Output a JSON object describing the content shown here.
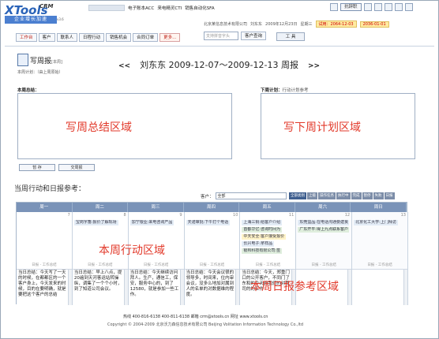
{
  "app": {
    "logo": "XTools",
    "logo_suffix": "CRM",
    "slogan": "企业增长加速",
    "version": "v3.6"
  },
  "topnav": [
    "电子账本ACC",
    "来电精灵CTI",
    "销售自动化SFA"
  ],
  "header": {
    "resign": "抗辞职",
    "company": "北京某信息技术有限公司",
    "user": "刘东东",
    "date": "2009年12月23日",
    "weekday": "星期三",
    "trial": "试用：2064-12-03",
    "end_date": "2036-01-01"
  },
  "nav": {
    "buttons": [
      "工作台",
      "客户",
      "联系人",
      "日程行动",
      "销售机会",
      "合同订单",
      "更多..."
    ],
    "search_placeholder": "支持拼音字头",
    "search_button": "客户查询",
    "tools": "工 具"
  },
  "report": {
    "title": "写周报",
    "subtitle": "[本周]",
    "prev": "<<",
    "next": ">>",
    "week_label": "刘东东 2009-12-07～2009-12-13 周报",
    "plan_hint": "本周计划：（由上周原始）",
    "summary_label": "本周总结：",
    "next_plan_label": "下周计划：",
    "next_plan_ref": "行动计划参考",
    "summary_area": "写周总结区域",
    "plan_area": "写下周计划区域",
    "save": "暂 存",
    "submit": "交周报"
  },
  "reference": {
    "title": "当周行动和日报参考：",
    "customer_label": "客户：",
    "customer_value": "全部",
    "filters": [
      "全部类别",
      "上级",
      "操作任务",
      "执行中",
      "完成",
      "暂停",
      "失败",
      "日报"
    ],
    "action_area": "本周行动区域",
    "daily_area": "本周日报参考区域"
  },
  "calendar": {
    "days": [
      "周一",
      "周二",
      "周三",
      "周四",
      "周五",
      "周六",
      "周日"
    ],
    "numbers": [
      "7",
      "8",
      "9",
      "10",
      "11",
      "12",
      "13"
    ],
    "actions": [
      [],
      [
        "宝岗字畜:报价了解现场"
      ],
      [
        "加宁银业:来电咨询产品"
      ],
      [
        "天诺审批:下午打个电话"
      ],
      [
        "上海三铜:给客户介绍",
        "首都华亿:咨询时间为",
        "中天安全:客户接受报价",
        "长兴电子:拿样品",
        "银邦科技有限公司:签"
      ],
      [
        "东莞益品:在电话沟通要建良",
        "广东开平:得上九点联系客户"
      ],
      [
        "北京化工大学:上门拜访"
      ]
    ],
    "summary_label": "日报 - 工作总结",
    "daily": [
      "当日总结：今天写了一天的时候，在都都区的一个客户身上，今天发来的时候，目的在要明确，就是要把这个客户的总结",
      "当日总结：早上八点，提20遍到天河客运站转操纵，调集了一个个小时，到了知道公司会议。",
      "当日总结：今天继续访问拜人。生产，通信工，保安，服务中心的，到了12580，就是参加一些工作。",
      "当日总结：今天会议很的领导多，时间来，位内审会议，没多么地加对属到人的名单的对数据维的程度。",
      "当日总结：今天，郑重门口的公开客户，不同门了东和的今天的我们的对我司的的工作",
      "",
      ""
    ]
  },
  "footer": {
    "line1": "热线 400-816-6138  400-811-6138  邮箱 crm@xtools.cn  网址 www.xtools.cn",
    "line2": "Copyright © 2004-2009  北京沃力森信息技术有限公司  Beijing Volitation Information Technology Co.,ltd"
  }
}
